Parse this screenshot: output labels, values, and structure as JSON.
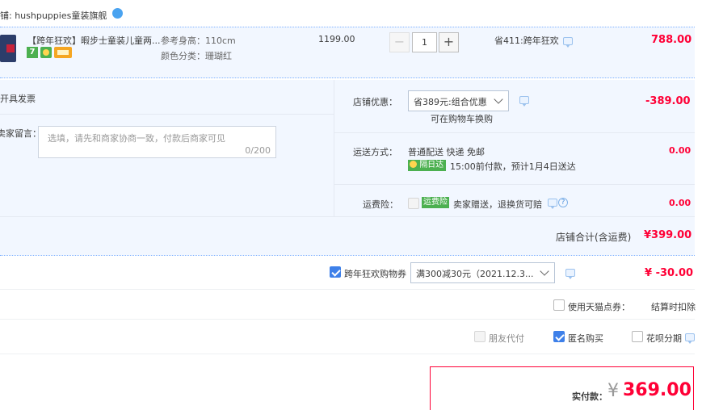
{
  "shop": {
    "label": "铺: hushpuppies童装旗舰"
  },
  "item": {
    "title": "【跨年狂欢】暇步士童装儿童两...",
    "attr_size": "参考身高：110cm",
    "attr_color": "颜色分类：珊瑚红",
    "price": "1199.00",
    "quantity": "1",
    "minus": "−",
    "plus": "+",
    "promo": "省411:跨年狂欢",
    "subtotal": "788.00",
    "badges": [
      "7",
      "天",
      "卡"
    ]
  },
  "invoice": {
    "label": "开具发票"
  },
  "message": {
    "label": "卖家留言：",
    "placeholder": "选填，请先和商家协商一致，付款后商家可见",
    "counter": "0/200"
  },
  "shop_discount": {
    "label": "店铺优惠：",
    "selected": "省389元:组合优惠",
    "note": "可在购物车换购",
    "amount": "-389.00"
  },
  "shipping": {
    "label": "运送方式：",
    "method": "普通配送 快递 免邮",
    "badge": "隔日达",
    "eta": "15:00前付款，预计1月4日送达",
    "amount": "0.00"
  },
  "insurance": {
    "label": "运费险：",
    "badge": "运费险",
    "text": "卖家赠送，退换货可赔",
    "amount": "0.00"
  },
  "shop_total": {
    "label": "店铺合计(含运费)",
    "amount": "¥399.00"
  },
  "coupon": {
    "label": "跨年狂欢购物券",
    "selected": "满300减30元（2021.12.3...",
    "amount": "¥ -30.00"
  },
  "tmall_points": {
    "label": "使用天猫点券：",
    "note": "结算时扣除"
  },
  "options": {
    "friend_pay": "朋友代付",
    "anonymous": "匿名购买",
    "huabei": "花呗分期"
  },
  "payment": {
    "label": "实付款：",
    "currency": "¥",
    "amount": "369.00"
  },
  "colors": {
    "accent": "#ff0036",
    "checkbox": "#3e80e9",
    "panel": "#f2f7ff",
    "green": "#4caf50"
  }
}
